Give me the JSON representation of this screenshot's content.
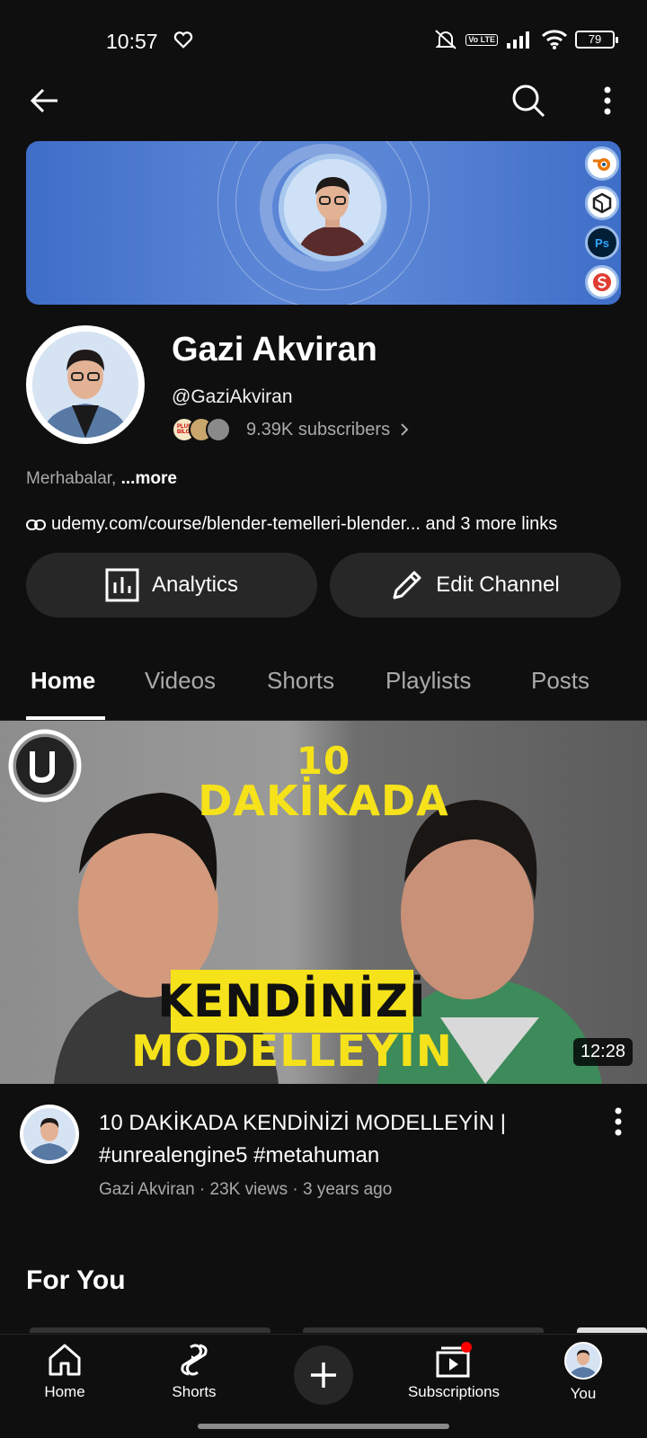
{
  "status_bar": {
    "time": "10:57",
    "battery": "79",
    "network": "Vo LTE"
  },
  "top_bar": {
    "back_icon": "arrow-left-icon",
    "search_icon": "search-icon",
    "more_icon": "more-vert-icon"
  },
  "banner": {
    "tools": [
      "blender-icon",
      "unity-icon",
      "photoshop-icon",
      "substance-icon"
    ],
    "photoshop_label": "Ps"
  },
  "channel": {
    "name": "Gazi Akviran",
    "handle": "@GaziAkviran",
    "subscribers": "9.39K subscribers",
    "mini_avatar_label": "PLUS BİLGİ",
    "description": "Merhabalar, ",
    "description_more": "...more",
    "link_text": "udemy.com/course/blender-temelleri-blender... and 3 more links"
  },
  "actions": {
    "analytics": "Analytics",
    "edit_channel": "Edit Channel"
  },
  "tabs": [
    {
      "label": "Home",
      "active": true
    },
    {
      "label": "Videos",
      "active": false
    },
    {
      "label": "Shorts",
      "active": false
    },
    {
      "label": "Playlists",
      "active": false
    },
    {
      "label": "Posts",
      "active": false
    }
  ],
  "video": {
    "thumb_line1": "10",
    "thumb_line2": "DAKİKADA",
    "thumb_line3": "KENDİNİZİ",
    "thumb_line4": "MODELLEYİN",
    "duration": "12:28",
    "title": "10 DAKİKADA KENDİNİZİ MODELLEYİN | #unrealengine5  #metahuman",
    "meta": "Gazi Akviran · 23K views · 3 years ago"
  },
  "section": {
    "for_you": "For You"
  },
  "bottom_nav": {
    "home": "Home",
    "shorts": "Shorts",
    "subscriptions": "Subscriptions",
    "you": "You"
  },
  "colors": {
    "background": "#0f0f0f",
    "button_bg": "#272727",
    "thumb_text": "#f5e21a",
    "notification_dot": "#ff0000"
  }
}
